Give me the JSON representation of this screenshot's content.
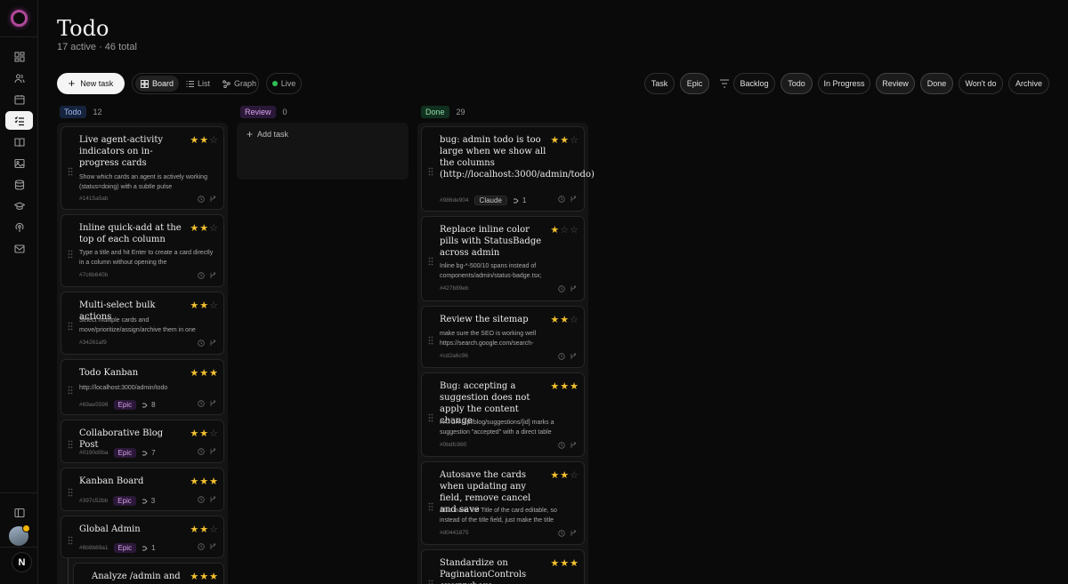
{
  "page": {
    "title": "Todo",
    "subtitle": "17 active · 46 total"
  },
  "toolbar": {
    "new_task": "New task",
    "views": [
      "Board",
      "List",
      "Graph"
    ],
    "live": "Live",
    "type_filters": [
      "Task",
      "Epic"
    ],
    "status_filters": [
      "Backlog",
      "Todo",
      "In Progress",
      "Review",
      "Done",
      "Won't do",
      "Archive"
    ]
  },
  "columns": {
    "todo": {
      "label": "Todo",
      "count": "12"
    },
    "review": {
      "label": "Review",
      "count": "0",
      "add_task": "Add task"
    },
    "done": {
      "label": "Done",
      "count": "29"
    }
  },
  "todo_cards": [
    {
      "title": "Live agent-activity indicators on in-progress cards",
      "stars": 2,
      "desc": "Show which cards an agent is actively working (status=doing) with a subtle pulse",
      "id": "#1415a5ab"
    },
    {
      "title": "Inline quick-add at the top of each column",
      "stars": 2,
      "desc": "Type a title and hit Enter to create a card directly in a column without opening the",
      "id": "#7c6b640b"
    },
    {
      "title": "Multi-select bulk actions",
      "stars": 2,
      "desc": "Select multiple cards and move/prioritize/assign/archive them in one",
      "id": "#34261af9"
    },
    {
      "title": "Todo Kanban",
      "stars": 3,
      "desc": "http://localhost:3000/admin/todo",
      "id": "#69ae5598",
      "tag": "Epic",
      "subtasks": "8"
    },
    {
      "title": "Collaborative Blog Post",
      "stars": 2,
      "id": "#0190d0ba",
      "tag": "Epic",
      "subtasks": "7"
    },
    {
      "title": "Kanban Board",
      "stars": 3,
      "id": "#397c52bb",
      "tag": "Epic",
      "subtasks": "3"
    },
    {
      "title": "Global Admin",
      "stars": 2,
      "id": "#6b9b89a1",
      "tag": "Epic",
      "subtasks": "1"
    },
    {
      "title": "Analyze /admin and",
      "stars": 3
    }
  ],
  "done_cards": [
    {
      "title": "bug: admin todo is too large when we show all the columns (http://localhost:3000/admin/todo)",
      "stars": 2,
      "id": "#986de904",
      "tag": "Claude",
      "subtasks": "1"
    },
    {
      "title": "Replace inline color pills with StatusBadge across admin",
      "stars": 1,
      "desc": "Inline bg-*-500/10 spans instead of components/admin/status-badge.tsx;",
      "id": "#427b89eb"
    },
    {
      "title": "Review the sitemap",
      "stars": 2,
      "desc": "make sure the SEO is working well https://search.google.com/search-",
      "id": "#cd2a6c96"
    },
    {
      "title": "Bug: accepting a suggestion does not apply the content change",
      "stars": 3,
      "desc": "PATCH /api/blog/suggestions/[id] marks a suggestion \"accepted\" with a direct table",
      "id": "#0bdfc980"
    },
    {
      "title": "Autosave the cards when updating any field, remove cancel and save",
      "stars": 2,
      "desc": "Also make the Title of the card editable, so instead of the title field, just make the title",
      "id": "#d0441875"
    },
    {
      "title": "Standardize on PaginationControls everywhere",
      "stars": 3
    }
  ],
  "colors": {
    "accent_star": "#f3c02f",
    "todo_badge": "#16233d",
    "review_badge": "#2b1838",
    "done_badge": "#12301f",
    "live_dot": "#2fbf55"
  },
  "icons": [
    "dashboard-icon",
    "users-icon",
    "calendar-icon",
    "todo-list-icon",
    "book-icon",
    "image-icon",
    "database-icon",
    "graduation-icon",
    "podcast-icon",
    "mail-icon",
    "panel-toggle-icon"
  ]
}
